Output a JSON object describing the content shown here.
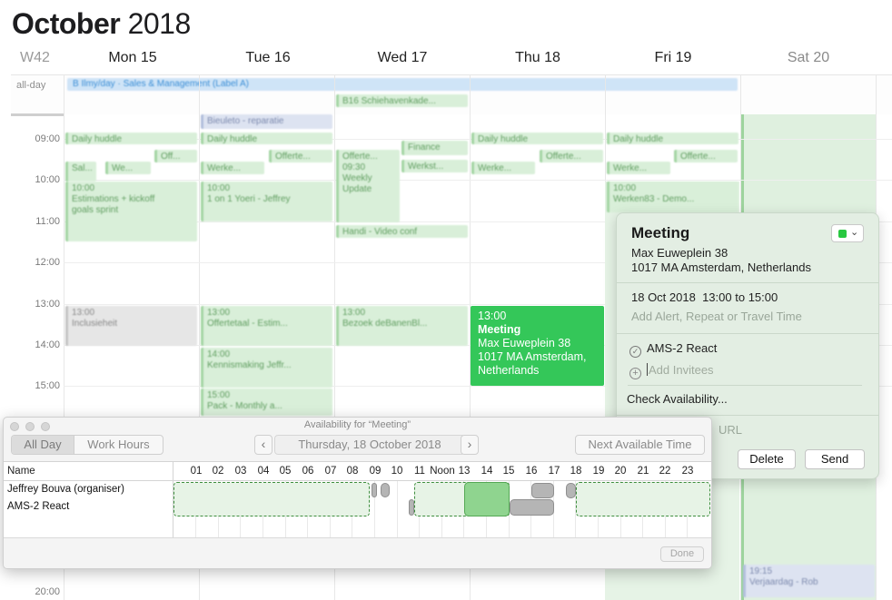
{
  "calendar": {
    "month": "October",
    "year": "2018",
    "week": "W42",
    "days": [
      "Mon 15",
      "Tue 16",
      "Wed 17",
      "Thu 18",
      "Fri 19",
      "Sat 20"
    ],
    "allday_label": "all-day",
    "hours": [
      "09:00",
      "10:00",
      "11:00",
      "12:00",
      "13:00",
      "14:00",
      "15:00",
      "20:00"
    ],
    "selected_event": {
      "time": "13:00",
      "title": "Meeting",
      "location_line1": "Max Euweplein 38",
      "location_line2": "1017 MA Amsterdam,",
      "location_line3": "Netherlands"
    }
  },
  "popover": {
    "title": "Meeting",
    "address_line1": "Max Euweplein 38",
    "address_line2": "1017 MA Amsterdam, Netherlands",
    "date": "18 Oct 2018",
    "start": "13:00",
    "to": "to",
    "end": "15:00",
    "alert_placeholder": "Add Alert, Repeat or Travel Time",
    "invitee": "AMS-2 React",
    "add_invitees_placeholder": "Add Invitees",
    "check_availability": "Check Availability...",
    "url_placeholder": "URL",
    "delete_label": "Delete",
    "send_label": "Send",
    "color": "#28c840"
  },
  "availability": {
    "window_title": "Availability for “Meeting”",
    "tab_all_day": "All Day",
    "tab_work_hours": "Work Hours",
    "date": "Thursday, 18 October 2018",
    "next_available": "Next Available Time",
    "name_header": "Name",
    "hour_labels": [
      "01",
      "02",
      "03",
      "04",
      "05",
      "06",
      "07",
      "08",
      "09",
      "10",
      "11",
      "Noon",
      "13",
      "14",
      "15",
      "16",
      "17",
      "18",
      "19",
      "20",
      "21",
      "22",
      "23"
    ],
    "attendees": [
      "Jeffrey Bouva (organiser)",
      "AMS-2 React"
    ],
    "done_label": "Done"
  }
}
